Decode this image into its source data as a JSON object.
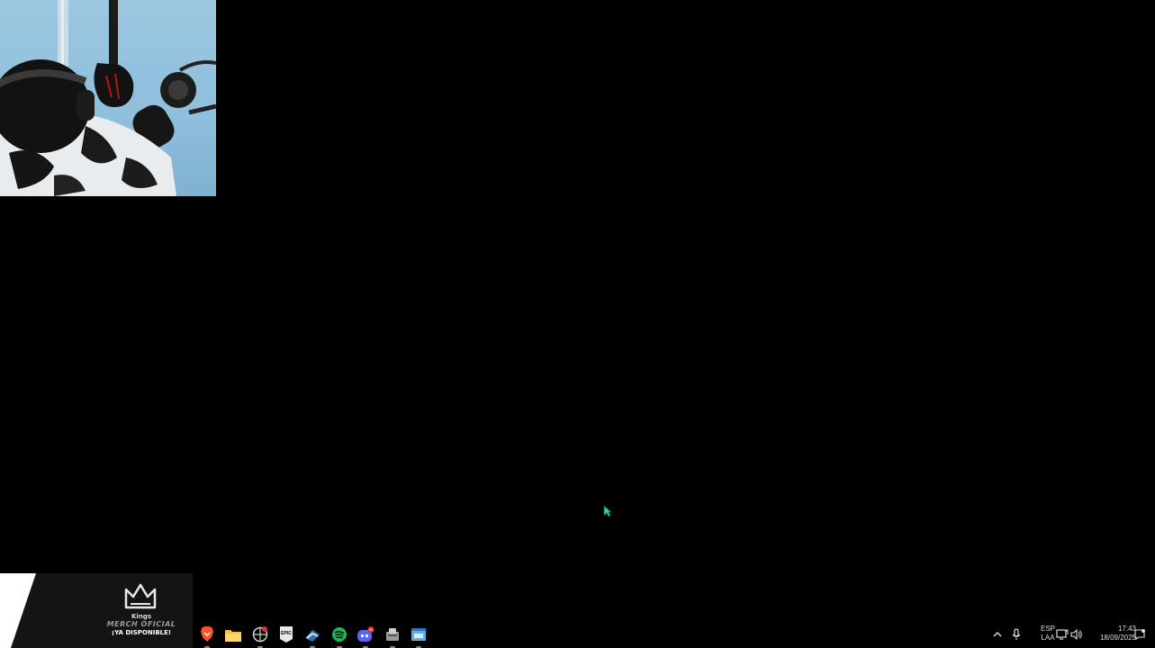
{
  "webcam": {
    "label": ""
  },
  "merch": {
    "brand": "Kings",
    "line": "MERCH OFICIAL",
    "sub": "¡YA DISPONIBLE!"
  },
  "taskbar": {
    "apps": [
      {
        "name": "brave",
        "icon": "brave-lion-icon",
        "color": "#fb542b"
      },
      {
        "name": "file-explorer",
        "icon": "folder-icon",
        "color": "#f6c244"
      },
      {
        "name": "browser-alt",
        "icon": "globe-icon",
        "color": "#cfcfcf"
      },
      {
        "name": "epic-games",
        "icon": "epic-games-icon",
        "color": "#e8e8e8"
      },
      {
        "name": "steam",
        "icon": "steam-icon",
        "color": "#2a75bb"
      },
      {
        "name": "spotify",
        "icon": "spotify-icon",
        "color": "#1db954"
      },
      {
        "name": "discord",
        "icon": "discord-icon",
        "color": "#5865f2",
        "badge": "99"
      },
      {
        "name": "app-tool",
        "icon": "tool-icon",
        "color": "#bbbbbb"
      },
      {
        "name": "app-window",
        "icon": "window-icon",
        "color": "#5ab0e8"
      }
    ],
    "tray": {
      "lang_top": "ESP",
      "lang_bottom": "LAA",
      "time": "17:43",
      "date": "18/09/2025"
    }
  },
  "colors": {
    "desktop": "#000000",
    "cursor": "#22d68a"
  }
}
